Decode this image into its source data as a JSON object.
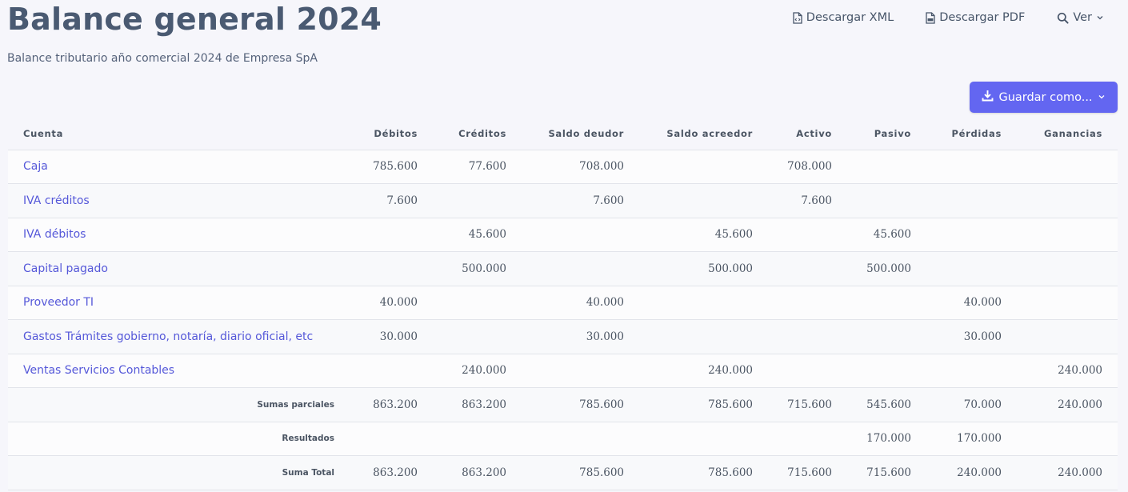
{
  "header": {
    "title": "Balance general 2024",
    "subtitle": "Balance tributario año comercial 2024 de Empresa SpA"
  },
  "actions": {
    "download_xml": "Descargar XML",
    "download_pdf": "Descargar PDF",
    "view": "Ver",
    "save_as": "Guardar como..."
  },
  "table": {
    "columns": [
      "Cuenta",
      "Débitos",
      "Créditos",
      "Saldo deudor",
      "Saldo acreedor",
      "Activo",
      "Pasivo",
      "Pérdidas",
      "Ganancias"
    ],
    "rows": [
      {
        "account": "Caja",
        "values": [
          "785.600",
          "77.600",
          "708.000",
          "",
          "708.000",
          "",
          "",
          ""
        ]
      },
      {
        "account": "IVA créditos",
        "values": [
          "7.600",
          "",
          "7.600",
          "",
          "7.600",
          "",
          "",
          ""
        ]
      },
      {
        "account": "IVA débitos",
        "values": [
          "",
          "45.600",
          "",
          "45.600",
          "",
          "45.600",
          "",
          ""
        ]
      },
      {
        "account": "Capital pagado",
        "values": [
          "",
          "500.000",
          "",
          "500.000",
          "",
          "500.000",
          "",
          ""
        ]
      },
      {
        "account": "Proveedor TI",
        "values": [
          "40.000",
          "",
          "40.000",
          "",
          "",
          "",
          "40.000",
          ""
        ]
      },
      {
        "account": "Gastos Trámites gobierno, notaría, diario oficial, etc",
        "values": [
          "30.000",
          "",
          "30.000",
          "",
          "",
          "",
          "30.000",
          ""
        ]
      },
      {
        "account": "Ventas Servicios Contables",
        "values": [
          "",
          "240.000",
          "",
          "240.000",
          "",
          "",
          "",
          "240.000"
        ]
      }
    ],
    "summary": [
      {
        "label": "Sumas parciales",
        "values": [
          "863.200",
          "863.200",
          "785.600",
          "785.600",
          "715.600",
          "545.600",
          "70.000",
          "240.000"
        ]
      },
      {
        "label": "Resultados",
        "values": [
          "",
          "",
          "",
          "",
          "",
          "170.000",
          "170.000",
          ""
        ]
      },
      {
        "label": "Suma Total",
        "values": [
          "863.200",
          "863.200",
          "785.600",
          "785.600",
          "715.600",
          "715.600",
          "240.000",
          "240.000"
        ]
      }
    ]
  },
  "colors": {
    "accent": "#6366f1",
    "link": "#5558d9",
    "title": "#4a5a72"
  }
}
